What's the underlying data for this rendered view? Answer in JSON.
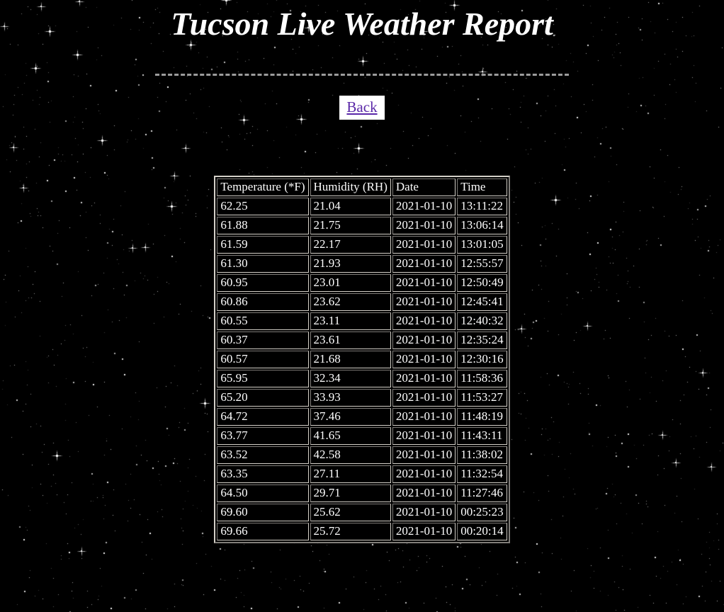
{
  "page": {
    "title": "Tucson Live Weather Report",
    "background_color": "#000000",
    "text_color": "#ffffff",
    "link_color": "#5a28a8",
    "rule_color": "#9b9b9b"
  },
  "nav": {
    "back_label": "Back"
  },
  "table": {
    "columns": [
      {
        "label": "Temperature (*F)",
        "key": "temperature"
      },
      {
        "label": "Humidity (RH)",
        "key": "humidity"
      },
      {
        "label": "Date",
        "key": "date"
      },
      {
        "label": "Time",
        "key": "time"
      }
    ],
    "rows": [
      {
        "temperature": "62.25",
        "humidity": "21.04",
        "date": "2021-01-10",
        "time": "13:11:22"
      },
      {
        "temperature": "61.88",
        "humidity": "21.75",
        "date": "2021-01-10",
        "time": "13:06:14"
      },
      {
        "temperature": "61.59",
        "humidity": "22.17",
        "date": "2021-01-10",
        "time": "13:01:05"
      },
      {
        "temperature": "61.30",
        "humidity": "21.93",
        "date": "2021-01-10",
        "time": "12:55:57"
      },
      {
        "temperature": "60.95",
        "humidity": "23.01",
        "date": "2021-01-10",
        "time": "12:50:49"
      },
      {
        "temperature": "60.86",
        "humidity": "23.62",
        "date": "2021-01-10",
        "time": "12:45:41"
      },
      {
        "temperature": "60.55",
        "humidity": "23.11",
        "date": "2021-01-10",
        "time": "12:40:32"
      },
      {
        "temperature": "60.37",
        "humidity": "23.61",
        "date": "2021-01-10",
        "time": "12:35:24"
      },
      {
        "temperature": "60.57",
        "humidity": "21.68",
        "date": "2021-01-10",
        "time": "12:30:16"
      },
      {
        "temperature": "65.95",
        "humidity": "32.34",
        "date": "2021-01-10",
        "time": "11:58:36"
      },
      {
        "temperature": "65.20",
        "humidity": "33.93",
        "date": "2021-01-10",
        "time": "11:53:27"
      },
      {
        "temperature": "64.72",
        "humidity": "37.46",
        "date": "2021-01-10",
        "time": "11:48:19"
      },
      {
        "temperature": "63.77",
        "humidity": "41.65",
        "date": "2021-01-10",
        "time": "11:43:11"
      },
      {
        "temperature": "63.52",
        "humidity": "42.58",
        "date": "2021-01-10",
        "time": "11:38:02"
      },
      {
        "temperature": "63.35",
        "humidity": "27.11",
        "date": "2021-01-10",
        "time": "11:32:54"
      },
      {
        "temperature": "64.50",
        "humidity": "29.71",
        "date": "2021-01-10",
        "time": "11:27:46"
      },
      {
        "temperature": "69.60",
        "humidity": "25.62",
        "date": "2021-01-10",
        "time": "00:25:23"
      },
      {
        "temperature": "69.66",
        "humidity": "25.72",
        "date": "2021-01-10",
        "time": "00:20:14"
      }
    ]
  }
}
